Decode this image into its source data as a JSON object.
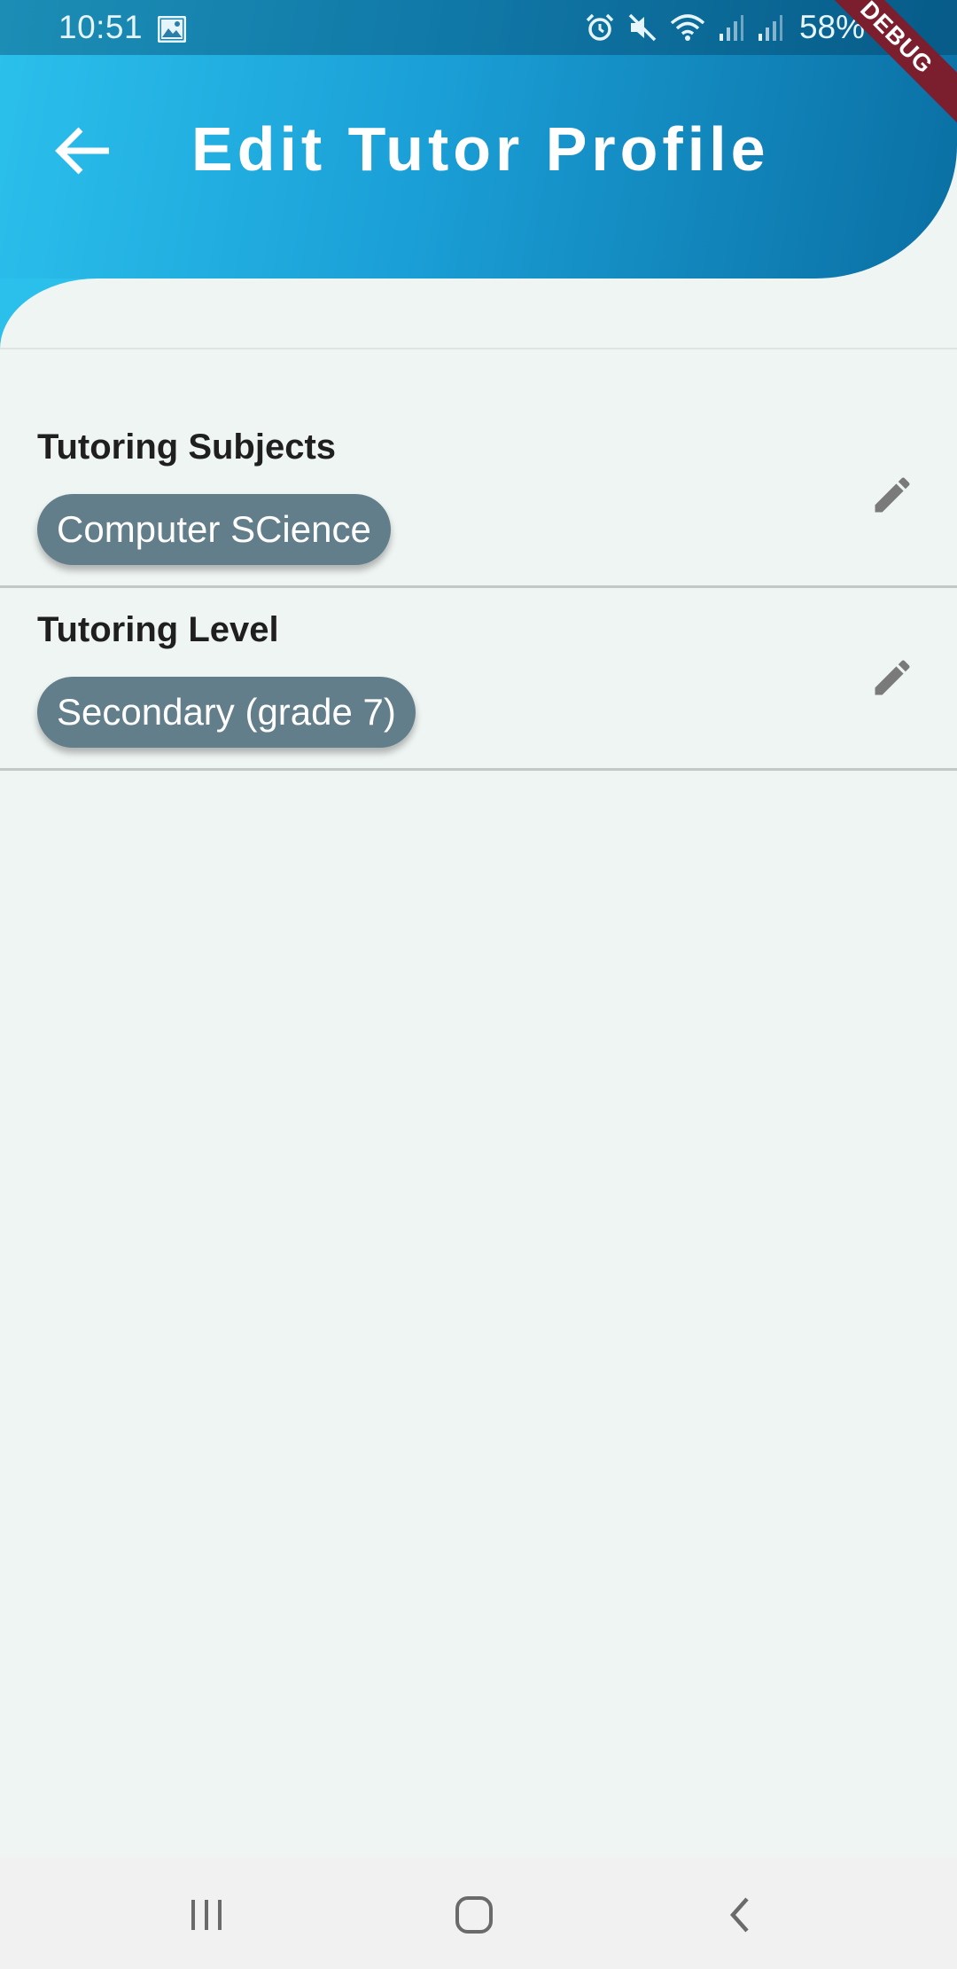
{
  "status_bar": {
    "time": "10:51",
    "battery": "58%",
    "icons": [
      "gallery-icon",
      "alarm-icon",
      "mute-icon",
      "wifi-icon",
      "signal-icon",
      "signal-icon",
      "battery-icon"
    ]
  },
  "debug_banner": "DEBUG",
  "header": {
    "title": "Edit Tutor Profile",
    "back_icon": "arrow-left-icon",
    "gradient_start": "#2bc0ec",
    "gradient_end": "#0a6fa3"
  },
  "sections": [
    {
      "title": "Tutoring Subjects",
      "chips": [
        "Computer SCience"
      ],
      "edit_icon": "pencil-icon"
    },
    {
      "title": "Tutoring Level",
      "chips": [
        "Secondary (grade 7)"
      ],
      "edit_icon": "pencil-icon"
    }
  ],
  "nav_bar": {
    "buttons": [
      "recent-apps-icon",
      "home-icon",
      "back-icon"
    ]
  },
  "colors": {
    "background": "#eff5f3",
    "chip": "#627e8b",
    "debug": "#7b1f2f"
  }
}
